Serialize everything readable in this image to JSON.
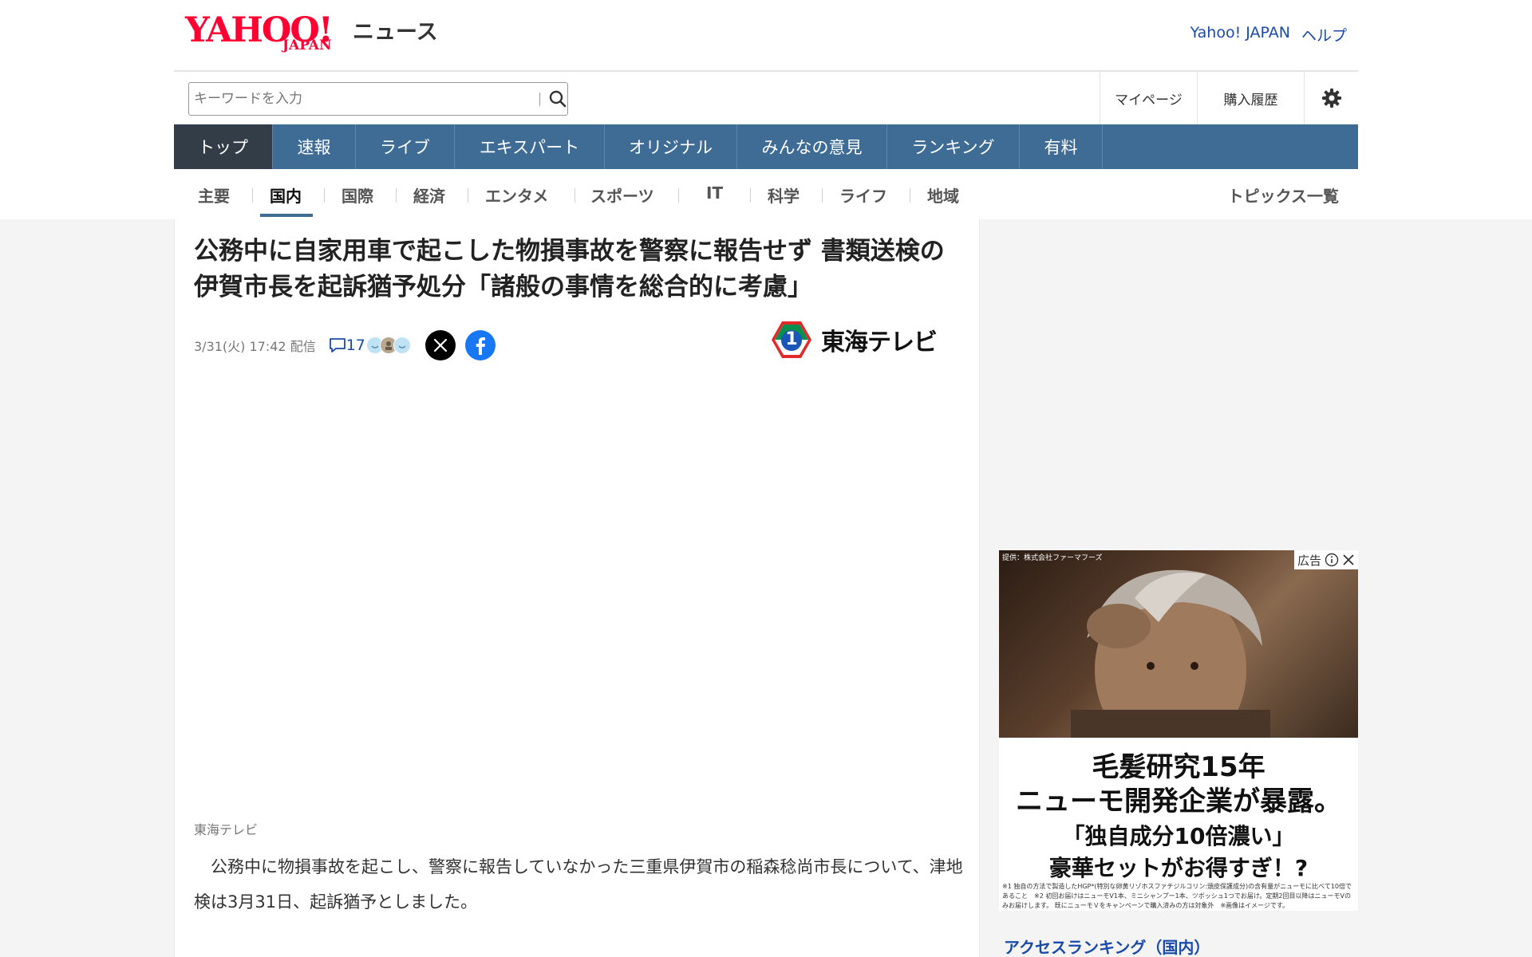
{
  "header": {
    "logo_text": "YAHOO!",
    "logo_sub": "JAPAN",
    "service_name": "ニュース",
    "links": [
      "Yahoo! JAPAN",
      "ヘルプ"
    ]
  },
  "search": {
    "placeholder": "キーワードを入力"
  },
  "util": {
    "mypage": "マイページ",
    "history": "購入履歴"
  },
  "nav": {
    "tabs": [
      "トップ",
      "速報",
      "ライブ",
      "エキスパート",
      "オリジナル",
      "みんなの意見",
      "ランキング",
      "有料"
    ],
    "active_tab": "トップ"
  },
  "categories": {
    "items": [
      "主要",
      "国内",
      "国際",
      "経済",
      "エンタメ",
      "スポーツ",
      "IT",
      "科学",
      "ライフ",
      "地域"
    ],
    "active": "国内",
    "topics_link": "トピックス一覧"
  },
  "article": {
    "headline": "公務中に自家用車で起こした物損事故を警察に報告せず 書類送検の伊賀市長を起訴猶予処分「諸般の事情を総合的に考慮」",
    "date": "3/31(火) 17:42 配信",
    "comment_count": "17",
    "media_name": "東海テレビ",
    "media_badge": "1",
    "source": "東海テレビ",
    "body": "公務中に物損事故を起こし、警察に報告していなかった三重県伊賀市の稲森稔尚市長について、津地検は3月31日、起訴猶予としました。"
  },
  "ad": {
    "provider": "提供：株式会社ファーマフーズ",
    "label": "広告",
    "line1": "毛髪研究15年",
    "line2": "ニューモ開発企業が暴露。",
    "line3": "「独自成分10倍濃い」",
    "line4": "豪華セットがお得すぎ！?",
    "fine_print": "※1 独自の方法で製造したHGP*(特別な卵黄リゾホスファチジルコリン:頭皮保護成分)の含有量がニューモに比べて10倍であること　※2 初回お届けはニューモV1本、ミニシャンプー1本、ツボッシュ1つでお届け。定期2回目以降はニューモVのみお届けします。 既にニューモＶをキャンペーンで購入済みの方は対象外　※画像はイメージです。"
  },
  "sidebar": {
    "ranking_title": "アクセスランキング（国内）"
  },
  "colors": {
    "nav_blue": "#3e6c95",
    "nav_active": "#333d47",
    "link_blue": "#1a4ba8",
    "logo_red": "#ff0033"
  }
}
